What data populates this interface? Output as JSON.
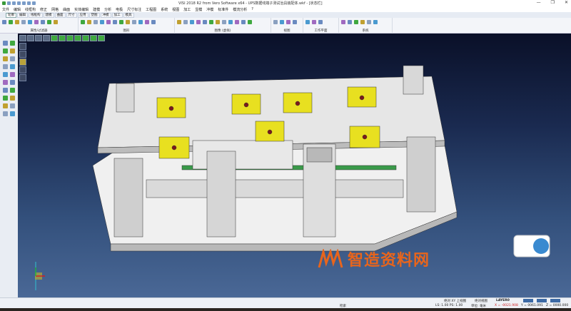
{
  "window": {
    "title": "VISI 2018 R2 from Vero Software x64 - UPS数据线端子测试治具装配体.wkf - [状态栏]",
    "minimize": "—",
    "maximize": "❐",
    "close": "✕"
  },
  "menu": [
    "文件",
    "编辑",
    "线框构",
    "修正",
    "网格",
    "曲面",
    "实体编辑",
    "建模",
    "分析",
    "电极",
    "尺寸标注",
    "工程图",
    "系统",
    "视图",
    "加工",
    "显模",
    "冲模",
    "标准件",
    "模流分析",
    "?"
  ],
  "tabs": [
    {
      "label": "轮廓",
      "active": true
    },
    {
      "label": "编辑"
    },
    {
      "label": "线框构"
    },
    {
      "label": "建模"
    },
    {
      "label": "曲面"
    },
    {
      "label": "尺寸"
    },
    {
      "label": "应用"
    },
    {
      "label": "塑图"
    },
    {
      "label": "冲模"
    },
    {
      "label": "加工"
    },
    {
      "label": "模具"
    }
  ],
  "ribbon_groups": [
    "属性/过滤器",
    "图形",
    "图像 (虚拟)",
    "视图",
    "工作平面",
    "系统"
  ],
  "watermark": {
    "text": "智造资料网",
    "color": "#e8651c"
  },
  "status": {
    "view": "绝对 XY 上视图",
    "view2": "绝对视图",
    "layer": "LAYER0",
    "mode": "检索",
    "scale": "LS: 1.00 PS: 1.00",
    "units": "单位: 毫米",
    "x": "X = -0021.908",
    "y": "Y = 0061.091",
    "z": "Z = 0000.000"
  },
  "colors": {
    "accent": "#3d6aa5",
    "part_yellow": "#e8e020",
    "part_gray": "#d8d8d8",
    "coord_red": "#d02020"
  }
}
